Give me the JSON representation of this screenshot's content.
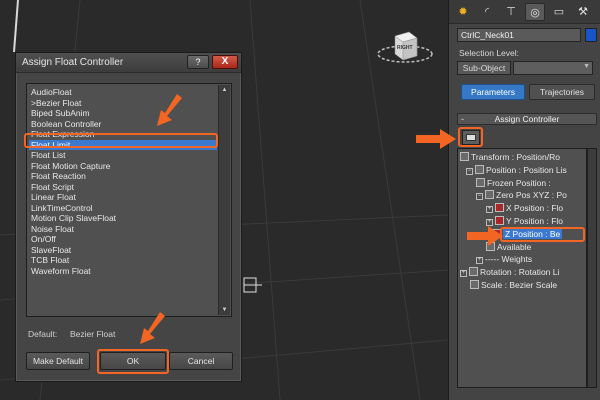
{
  "dialog": {
    "title": "Assign Float Controller",
    "help_label": "?",
    "close_label": "X",
    "controllers": [
      "AudioFloat",
      ">Bezier Float",
      "Biped SubAnim",
      "Boolean Controller",
      "Float Expression",
      "Float Limit",
      "Float List",
      "Float Motion Capture",
      "Float Reaction",
      "Float Script",
      "Linear Float",
      "LinkTimeControl",
      "Motion Clip SlaveFloat",
      "Noise Float",
      "On/Off",
      "SlaveFloat",
      "TCB Float",
      "Waveform Float"
    ],
    "selected_controller": "Float Limit",
    "default_label": "Default:",
    "default_value": "Bezier Float",
    "make_default_label": "Make Default",
    "ok_label": "OK",
    "cancel_label": "Cancel"
  },
  "viewport": {
    "viewcube_label": "RIGHT"
  },
  "command_panel": {
    "tab_icons": [
      "create-icon",
      "modify-icon",
      "hierarchy-icon",
      "motion-icon",
      "display-icon",
      "utilities-icon"
    ],
    "object_name": "CtrlC_Neck01",
    "object_color": "#1a55c8",
    "selection_level_label": "Selection Level:",
    "subobject_label": "Sub-Object",
    "tabs": [
      "Parameters",
      "Trajectories"
    ],
    "active_tab": "Parameters",
    "rollout_title": "Assign Controller",
    "rollout_toggle": "-",
    "tree": [
      {
        "label": "Transform : Position/Ro",
        "expander": "",
        "icon": "plain"
      },
      {
        "label": "Position : Position Lis",
        "expander": "−",
        "icon": "plain"
      },
      {
        "label": "Frozen Position :",
        "expander": "",
        "icon": "plain"
      },
      {
        "label": "Zero Pos XYZ : Po",
        "expander": "−",
        "icon": "plain"
      },
      {
        "label": "X Position : Flo",
        "expander": "+",
        "icon": "red"
      },
      {
        "label": "Y Position : Flo",
        "expander": "+",
        "icon": "red"
      },
      {
        "label": "Z Position : Be",
        "expander": "",
        "icon": "red"
      },
      {
        "label": "Available",
        "expander": "",
        "icon": "plain"
      },
      {
        "label": "----- Weights",
        "expander": "+",
        "icon": ""
      },
      {
        "label": "Rotation : Rotation Li",
        "expander": "+",
        "icon": "plain"
      },
      {
        "label": "Scale : Bezier Scale",
        "expander": "",
        "icon": "plain"
      }
    ],
    "selected_tree_item": "Z Position : Be"
  },
  "colors": {
    "accent": "#f26522",
    "selection": "#3b78d0",
    "close_button": "#c0392b"
  }
}
